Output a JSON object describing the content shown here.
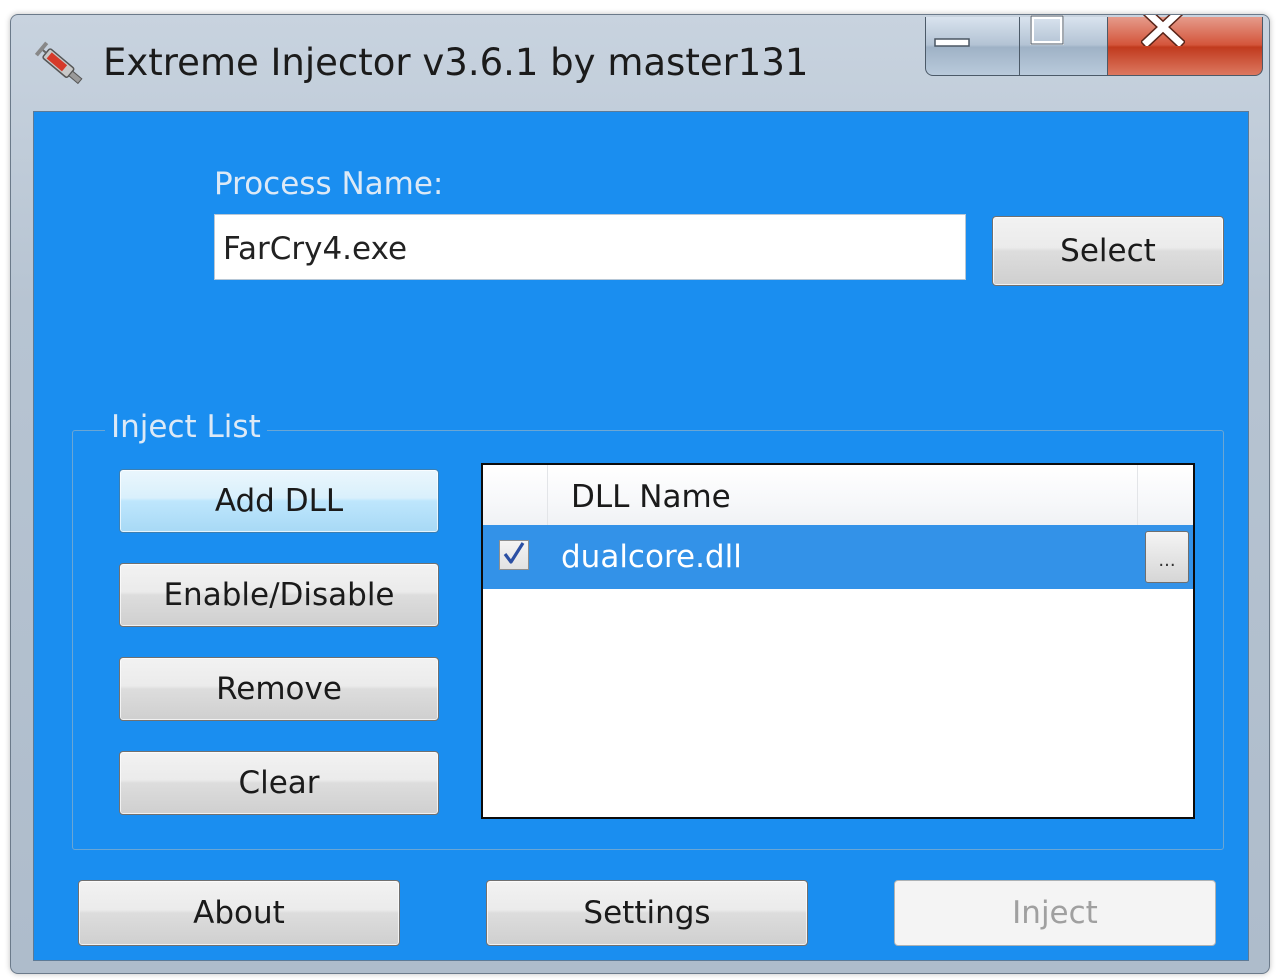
{
  "window": {
    "title": "Extreme Injector v3.6.1 by master131"
  },
  "process": {
    "label": "Process Name:",
    "value": "FarCry4.exe",
    "select_label": "Select"
  },
  "inject_list": {
    "legend": "Inject List",
    "buttons": {
      "add": "Add DLL",
      "enable_disable": "Enable/Disable",
      "remove": "Remove",
      "clear": "Clear"
    },
    "column_header": "DLL Name",
    "rows": [
      {
        "name": "dualcore.dll",
        "checked": true,
        "browse_label": "..."
      }
    ]
  },
  "footer": {
    "about": "About",
    "settings": "Settings",
    "inject": "Inject"
  },
  "colors": {
    "client_background": "#1a8ef0",
    "selected_row": "#3392e8",
    "label_text": "#dce9f6"
  },
  "icons": {
    "app": "syringe-icon",
    "minimize": "minimize-icon",
    "maximize": "maximize-icon",
    "close": "close-icon",
    "check": "checkmark-icon"
  }
}
